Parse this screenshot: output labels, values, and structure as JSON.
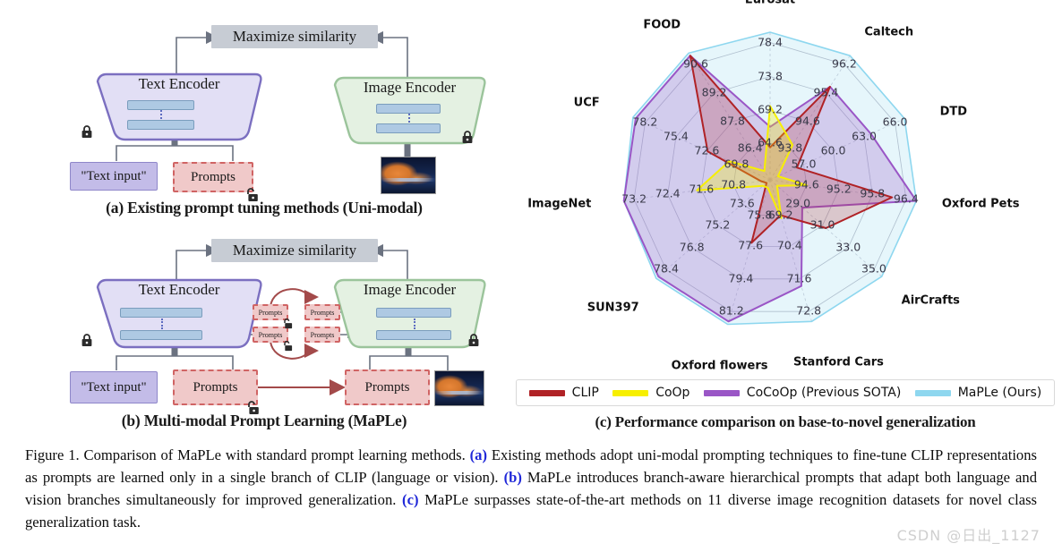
{
  "panel_a": {
    "subcaption": "(a) Existing prompt tuning methods (Uni-modal)",
    "maximize_similarity": "Maximize similarity",
    "text_encoder": "Text Encoder",
    "image_encoder": "Image Encoder",
    "text_input": "\"Text input\"",
    "prompts": "Prompts"
  },
  "panel_b": {
    "subcaption": "(b) Multi-modal Prompt Learning (MaPLe)",
    "maximize_similarity": "Maximize similarity",
    "text_encoder": "Text Encoder",
    "image_encoder": "Image Encoder",
    "text_input": "\"Text input\"",
    "prompts": "Prompts",
    "mini_prompts": "Prompts"
  },
  "panel_c": {
    "subcaption": "(c) Performance comparison on base-to-novel generalization"
  },
  "chart_data": {
    "type": "radar",
    "title": "Performance comparison on base-to-novel generalization",
    "legend_position": "bottom",
    "grid": true,
    "rings": 4,
    "categories": [
      "Eurosat",
      "Caltech",
      "DTD",
      "Oxford Pets",
      "AirCrafts",
      "Stanford Cars",
      "Oxford flowers",
      "SUN397",
      "ImageNet",
      "UCF",
      "FOOD"
    ],
    "axis_ticks": {
      "Eurosat": [
        64.6,
        69.2,
        73.8,
        78.4
      ],
      "Caltech": [
        93.8,
        94.6,
        95.4,
        96.2
      ],
      "DTD": [
        57.0,
        60.0,
        63.0,
        66.0
      ],
      "Oxford Pets": [
        94.6,
        95.2,
        95.8,
        96.4
      ],
      "AirCrafts": [
        29.0,
        31.0,
        33.0,
        35.0
      ],
      "Stanford Cars": [
        69.2,
        70.4,
        71.6,
        72.8
      ],
      "Oxford flowers": [
        75.8,
        77.6,
        79.4,
        81.2
      ],
      "SUN397": [
        73.6,
        75.2,
        76.8,
        78.4
      ],
      "ImageNet": [
        70.8,
        71.6,
        72.4,
        73.2
      ],
      "UCF": [
        69.8,
        72.6,
        75.4,
        78.2
      ],
      "FOOD": [
        86.4,
        87.8,
        89.2,
        90.6
      ]
    },
    "axis_ranges": {
      "Eurosat": [
        60.0,
        78.4
      ],
      "Caltech": [
        93.0,
        96.2
      ],
      "DTD": [
        54.0,
        66.0
      ],
      "Oxford Pets": [
        94.0,
        96.4
      ],
      "AirCrafts": [
        27.0,
        35.0
      ],
      "Stanford Cars": [
        68.0,
        72.8
      ],
      "Oxford flowers": [
        74.0,
        81.2
      ],
      "SUN397": [
        72.0,
        78.4
      ],
      "ImageNet": [
        70.0,
        73.2
      ],
      "UCF": [
        67.0,
        78.2
      ],
      "FOOD": [
        85.0,
        90.6
      ]
    },
    "series": [
      {
        "name": "CLIP",
        "color": "#b02226",
        "values": [
          64.05,
          95.4,
          56.4,
          96.0,
          31.0,
          69.2,
          77.2,
          72.2,
          70.2,
          72.2,
          90.6
        ]
      },
      {
        "name": "CoOp",
        "color": "#f7ef00",
        "values": [
          69.2,
          93.9,
          54.7,
          94.6,
          27.5,
          69.3,
          74.4,
          72.4,
          71.6,
          70.4,
          85.4
        ]
      },
      {
        "name": "CoCoOp (Previous SOTA)",
        "color": "#9a56c6",
        "values": [
          66.6,
          95.4,
          63.0,
          96.4,
          29.3,
          71.6,
          81.2,
          78.4,
          73.2,
          78.2,
          90.6
        ]
      },
      {
        "name": "MaPLe (Ours)",
        "color": "#8ed7ef",
        "values": [
          78.4,
          96.2,
          66.0,
          96.4,
          35.0,
          72.8,
          81.8,
          79.1,
          73.2,
          79.2,
          91.0
        ]
      }
    ]
  },
  "legend": {
    "items": [
      {
        "label": "CLIP",
        "color": "#b02226"
      },
      {
        "label": "CoOp",
        "color": "#f7ef00"
      },
      {
        "label": "CoCoOp (Previous SOTA)",
        "color": "#9a56c6"
      },
      {
        "label": "MaPLe (Ours)",
        "color": "#8ed7ef"
      }
    ]
  },
  "caption": {
    "lead": "Figure 1. Comparison of MaPLe with standard prompt learning methods. ",
    "ref_a": "(a)",
    "seg_a": " Existing methods adopt uni-modal prompting techniques to fine-tune CLIP representations as prompts are learned only in a single branch of CLIP (language or vision). ",
    "ref_b": "(b)",
    "seg_b": " MaPLe introduces branch-aware hierarchical prompts that adapt both language and vision branches simultaneously for improved generalization. ",
    "ref_c": "(c)",
    "seg_c": " MaPLe surpasses state-of-the-art methods on 11 diverse image recognition datasets for novel class generalization task."
  },
  "watermark": "CSDN @日出_1127"
}
